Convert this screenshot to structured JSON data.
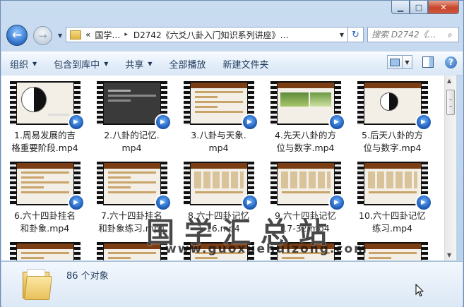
{
  "window": {
    "caption_min": "▁",
    "caption_max": "□",
    "caption_close": "✕"
  },
  "nav": {
    "back_glyph": "←",
    "forward_glyph": "→",
    "breadcrumb": [
      "«",
      "国学…",
      "▸",
      "D2742《六爻八卦入门知识系列讲座》…",
      "▸"
    ],
    "search_placeholder": "搜索 D2742《…"
  },
  "toolbar": {
    "items": [
      {
        "label": "组织",
        "dropdown": true
      },
      {
        "label": "包含到库中",
        "dropdown": true
      },
      {
        "label": "共享",
        "dropdown": true
      },
      {
        "label": "全部播放",
        "dropdown": false
      },
      {
        "label": "新建文件夹",
        "dropdown": false
      }
    ],
    "help": "?"
  },
  "files": [
    {
      "name": "1.周易发展的吉\n格重要阶段.mp4",
      "thumb": "yinyang"
    },
    {
      "name": "2.八卦的记忆.\nmp4",
      "thumb": "dark"
    },
    {
      "name": "3.八卦与天象.\nmp4",
      "thumb": "text"
    },
    {
      "name": "4.先天八卦的方\n位与数字.mp4",
      "thumb": "pics"
    },
    {
      "name": "5.后天八卦的方\n位与数字.mp4",
      "thumb": "diagram"
    },
    {
      "name": "6.六十四卦挂名\n和卦象.mp4",
      "thumb": "text"
    },
    {
      "name": "7.六十四卦挂名\n和卦象练习.mp4",
      "thumb": "text"
    },
    {
      "name": "8.六十四卦记忆\n1-16.mp4",
      "thumb": "table"
    },
    {
      "name": "9.六十四卦记忆\n17-32.mp4",
      "thumb": "table"
    },
    {
      "name": "10.六十四卦记忆\n练习.mp4",
      "thumb": "table"
    },
    {
      "name": "",
      "thumb": "text"
    },
    {
      "name": "",
      "thumb": "text"
    },
    {
      "name": "",
      "thumb": "text"
    },
    {
      "name": "",
      "thumb": "text"
    },
    {
      "name": "",
      "thumb": "text"
    }
  ],
  "watermark": {
    "title": "国学汇总站",
    "url": "www.guoxuehuizong.com"
  },
  "details": {
    "count": "86 个对象"
  }
}
